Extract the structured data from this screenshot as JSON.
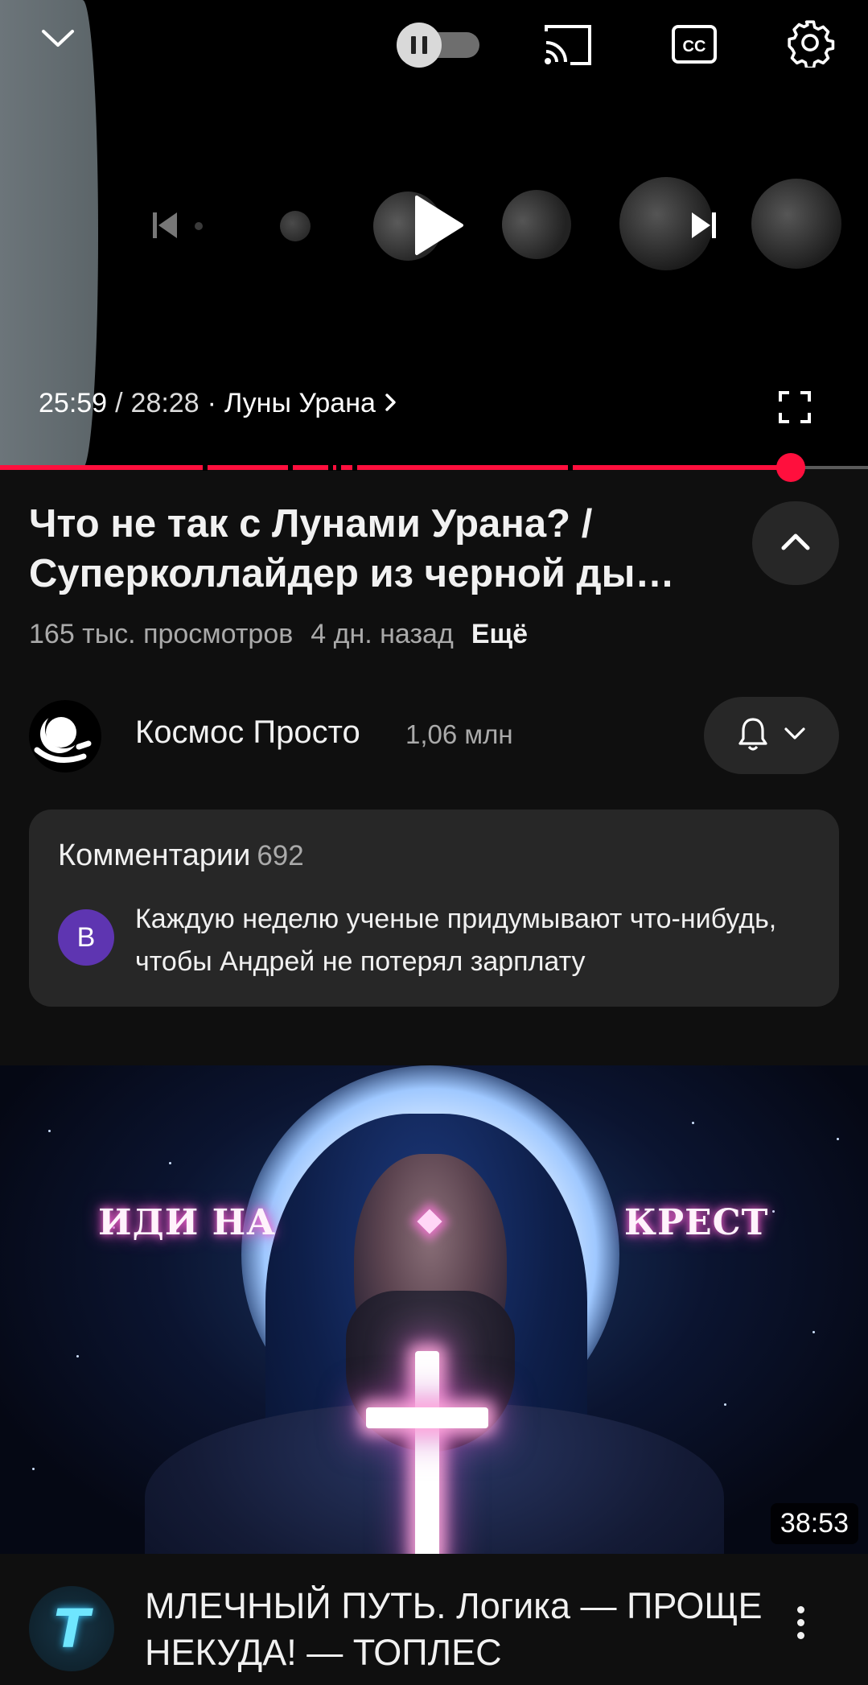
{
  "player": {
    "current_time": "25:59",
    "separator": "/",
    "total_time": "28:28",
    "chapter_prefix": "·",
    "chapter": "Луны Урана",
    "progress_fraction": 0.911,
    "icons": {
      "minimize": "chevron-down-icon",
      "autoplay": "autoplay-toggle-pause-icon",
      "cast": "cast-icon",
      "captions": "cc-icon",
      "settings": "gear-icon",
      "previous": "skip-previous-icon",
      "play": "play-icon",
      "next": "skip-next-icon",
      "fullscreen": "fullscreen-icon",
      "chapter_arrow": "chevron-right-icon"
    },
    "captions_label": "CC",
    "accent_color": "#ff0f3d"
  },
  "video": {
    "title": "Что не так с Лунами Урана? / Суперколлайдер из черной ды…",
    "views": "165 тыс. просмотров",
    "age": "4 дн. назад",
    "more_label": "Ещё"
  },
  "channel": {
    "name": "Космос Просто",
    "subscribers": "1,06 млн",
    "icons": {
      "notifications": "bell-icon",
      "dropdown": "chevron-down-icon"
    }
  },
  "comments": {
    "label": "Комментарии",
    "count": "692",
    "top_comment": {
      "avatar_letter": "B",
      "avatar_color": "#5e35b1",
      "text": "Каждую неделю ученые придумывают что-нибудь, чтобы Андрей не потерял зарплату"
    }
  },
  "next_video": {
    "thumbnail_words": [
      "ИДИ НА",
      "КРЕСТ"
    ],
    "duration": "38:53",
    "channel_avatar_letter": "T",
    "title": "МЛЕЧНЫЙ ПУТЬ. Логика — ПРОЩЕ НЕКУДА! — ТОПЛЕС",
    "menu_icon": "more-vertical-icon"
  }
}
